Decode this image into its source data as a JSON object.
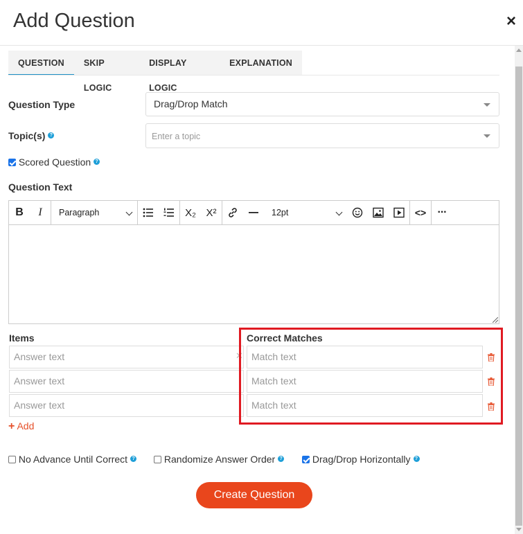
{
  "dialog": {
    "title": "Add Question",
    "close_label": "×"
  },
  "tabs": [
    {
      "label": "QUESTION",
      "active": true
    },
    {
      "label": "SKIP LOGIC",
      "active": false
    },
    {
      "label": "DISPLAY LOGIC",
      "active": false
    },
    {
      "label": "EXPLANATION",
      "active": false
    }
  ],
  "form": {
    "question_type": {
      "label": "Question Type",
      "value": "Drag/Drop Match"
    },
    "topics": {
      "label": "Topic(s)",
      "placeholder": "Enter a topic",
      "help": "?"
    },
    "scored": {
      "label": "Scored Question",
      "checked": true,
      "help": "?"
    },
    "question_text": {
      "label": "Question Text"
    }
  },
  "editor_toolbar": {
    "bold": "B",
    "italic": "I",
    "block_format": "Paragraph",
    "font_size": "12pt",
    "subscript": "X₂",
    "superscript": "X²",
    "code": "<>",
    "more": "···"
  },
  "match": {
    "items_label": "Items",
    "matches_label": "Correct Matches",
    "rows": [
      {
        "item_placeholder": "Answer text",
        "match_placeholder": "Match text"
      },
      {
        "item_placeholder": "Answer text",
        "match_placeholder": "Match text"
      },
      {
        "item_placeholder": "Answer text",
        "match_placeholder": "Match text"
      }
    ],
    "add_label": "Add",
    "add_icon": "+"
  },
  "options": [
    {
      "label": "No Advance Until Correct",
      "checked": false,
      "help": "?"
    },
    {
      "label": "Randomize Answer Order",
      "checked": false,
      "help": "?"
    },
    {
      "label": "Drag/Drop Horizontally",
      "checked": true,
      "help": "?"
    }
  ],
  "submit": {
    "label": "Create Question"
  },
  "colors": {
    "accent": "#e9461c",
    "tab_active": "#1e90c6",
    "highlight": "#e01a22",
    "help": "#1e9fd8",
    "trash": "#e6502a"
  }
}
